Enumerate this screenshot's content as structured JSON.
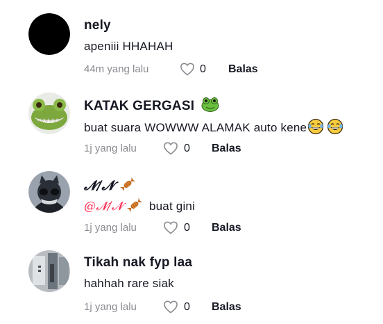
{
  "comments": [
    {
      "username": "nely",
      "text": "apeniii HHAHAH",
      "time": "44m yang lalu",
      "likes": "0",
      "reply_label": "Balas",
      "avatar": "black-circle-avatar"
    },
    {
      "username": "KATAK GERGASI",
      "username_emoji": "frog-face-icon",
      "text": "buat suara WOWWW ALAMAK auto kene",
      "text_emojis": [
        "tears-of-joy-icon",
        "tears-of-joy-icon"
      ],
      "time": "1j yang lalu",
      "likes": "0",
      "reply_label": "Balas",
      "avatar": "frog-avatar"
    },
    {
      "username": "𝓝/𝓝",
      "username_emoji": "candy-icon",
      "mention": "@𝓝/𝓝",
      "mention_emoji": "candy-icon",
      "text": "buat gini",
      "time": "1j yang lalu",
      "likes": "0",
      "reply_label": "Balas",
      "avatar": "cat-avatar"
    },
    {
      "username": "Tikah nak fyp laa",
      "text": "hahhah rare siak",
      "time": "1j yang lalu",
      "likes": "0",
      "reply_label": "Balas",
      "avatar": "room-photo-avatar"
    }
  ],
  "colors": {
    "text_primary": "#161823",
    "text_secondary": "#8a8b91",
    "mention": "#fe2c55"
  }
}
